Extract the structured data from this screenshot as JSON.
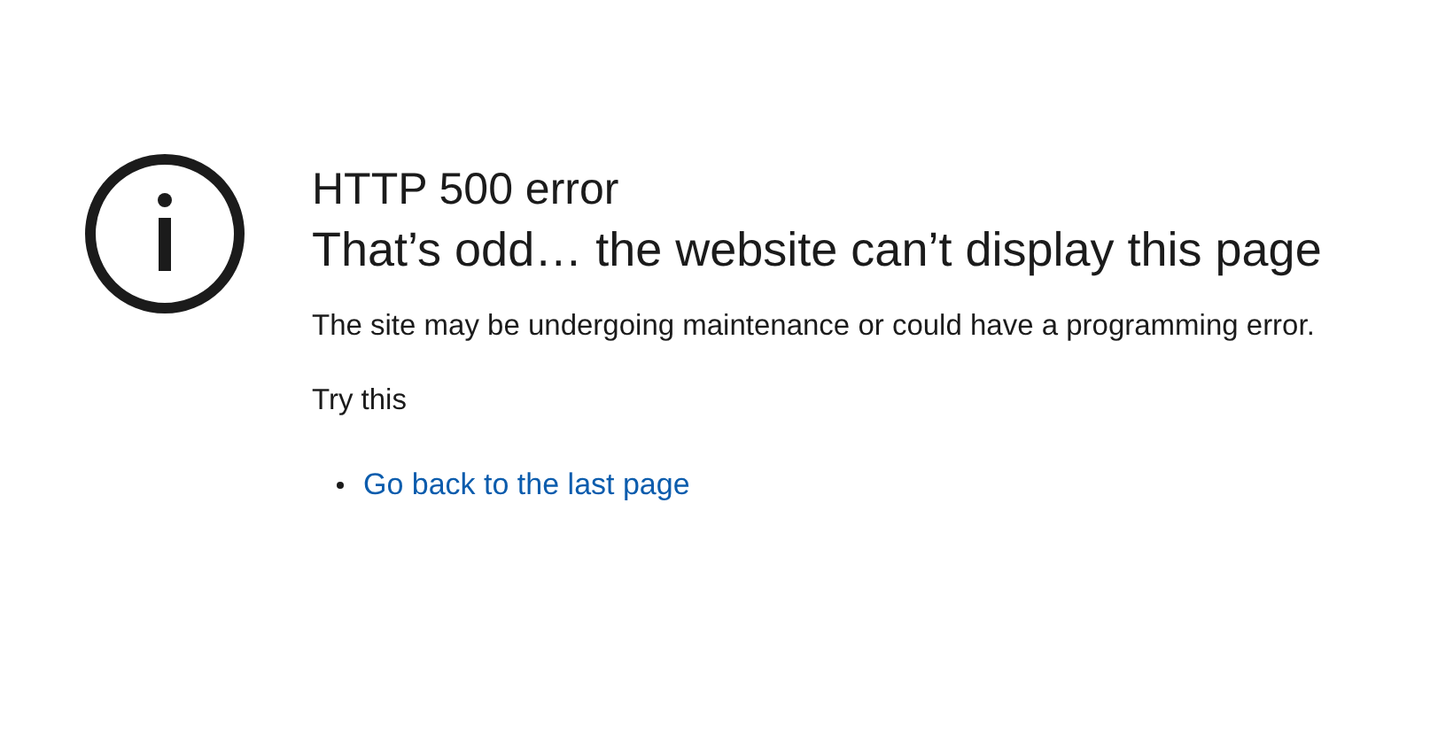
{
  "error_code": "HTTP 500 error",
  "heading": "That’s odd… the website can’t display this page",
  "description": "The site may be undergoing maintenance or could have a programming error.",
  "suggestions_title": "Try this",
  "suggestions": [
    {
      "label": "Go back to the last page",
      "kind": "link"
    }
  ]
}
